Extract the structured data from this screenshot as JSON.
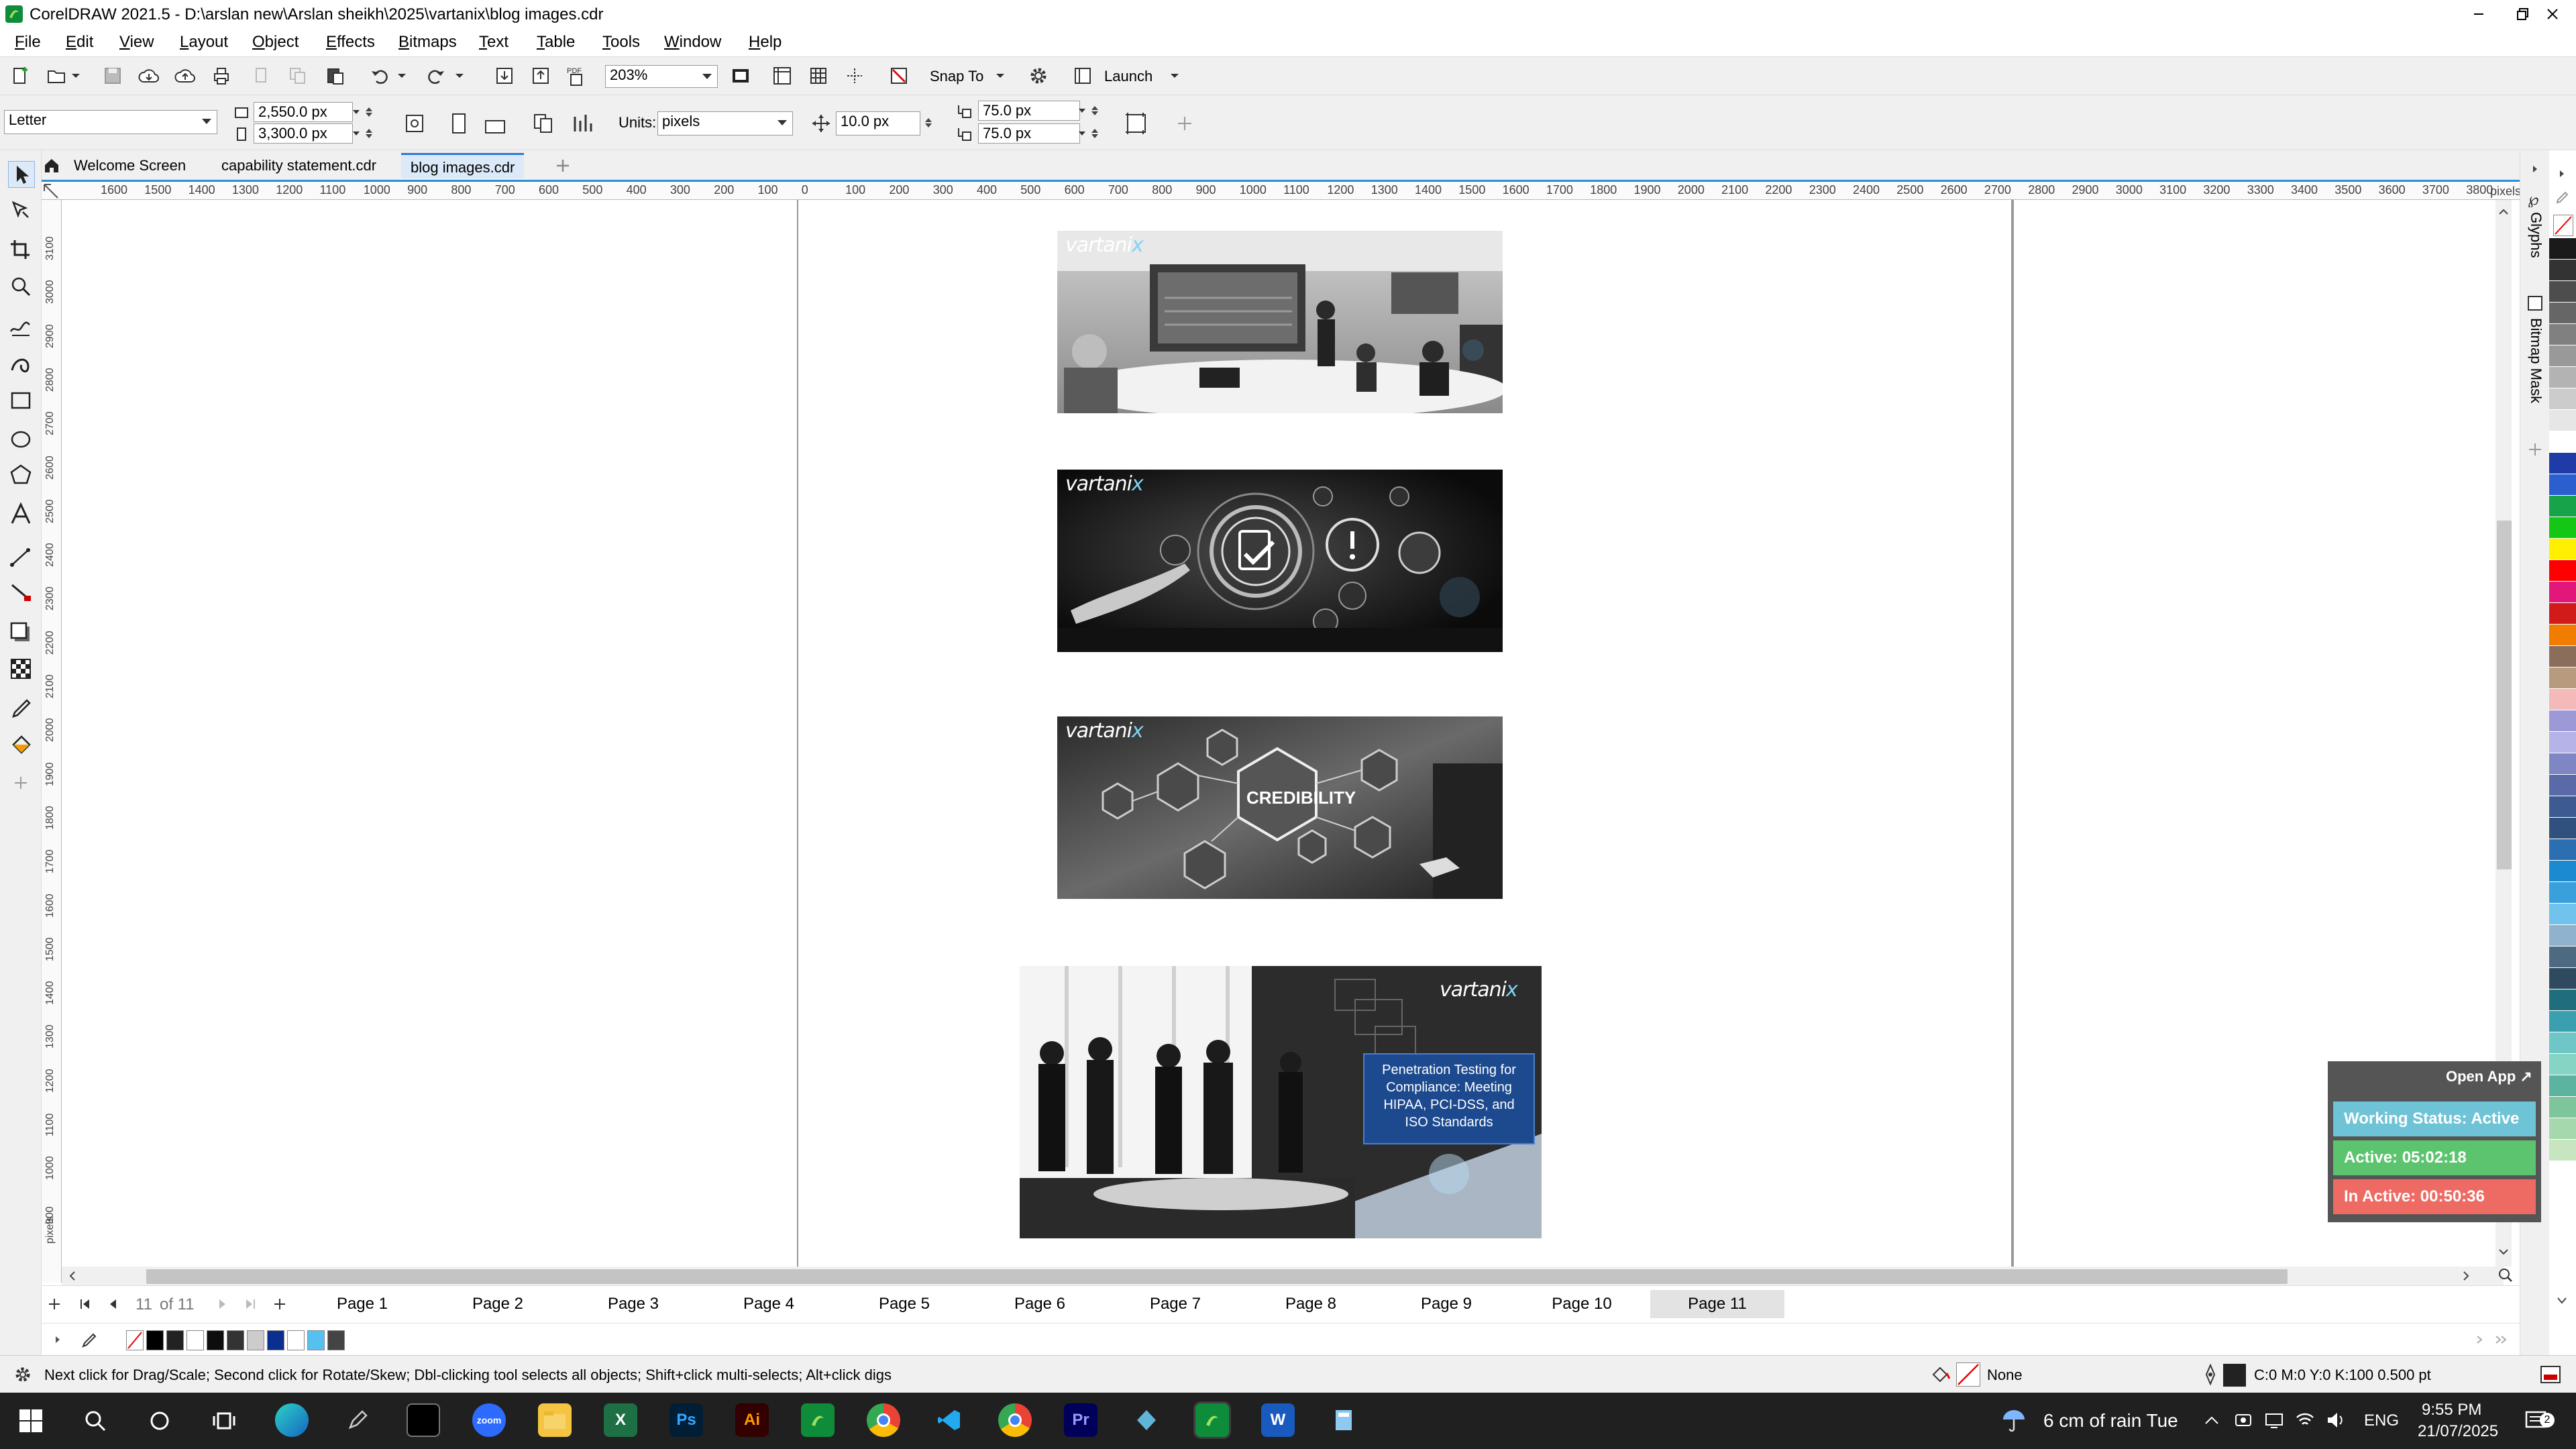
{
  "window": {
    "title": "CorelDRAW 2021.5 - D:\\arslan new\\Arslan sheikh\\2025\\vartanix\\blog images.cdr"
  },
  "menu": [
    "File",
    "Edit",
    "View",
    "Layout",
    "Object",
    "Effects",
    "Bitmaps",
    "Text",
    "Table",
    "Tools",
    "Window",
    "Help"
  ],
  "toolbar": {
    "zoom": "203%",
    "snap_to": "Snap To",
    "launch": "Launch"
  },
  "property_bar": {
    "page_size": "Letter",
    "width": "2,550.0 px",
    "height": "3,300.0 px",
    "units_label": "Units:",
    "units": "pixels",
    "nudge": "10.0 px",
    "dup_x": "75.0 px",
    "dup_y": "75.0 px"
  },
  "tabs": [
    "Welcome Screen",
    "capability statement.cdr",
    "blog images.cdr"
  ],
  "ruler": {
    "h_ticks": [
      "1600",
      "1500",
      "1400",
      "1300",
      "1200",
      "1100",
      "1000",
      "900",
      "800",
      "700",
      "600",
      "500",
      "400",
      "300",
      "200",
      "100",
      "0",
      "100",
      "200",
      "300",
      "400",
      "500",
      "600",
      "700",
      "800",
      "900",
      "1000",
      "1100",
      "1200",
      "1300",
      "1400",
      "1500",
      "1600",
      "1700",
      "1800",
      "1900",
      "2000",
      "2100",
      "2200",
      "2300",
      "2400",
      "2500",
      "2600",
      "2700",
      "2800",
      "2900",
      "3000",
      "3100",
      "3200",
      "3300",
      "3400",
      "3500",
      "3600",
      "3700",
      "3800"
    ],
    "unit": "pixels",
    "v_ticks": [
      "3100",
      "3000",
      "2900",
      "2800",
      "2700",
      "2600",
      "2500",
      "2400",
      "2300",
      "2200",
      "2100",
      "2000",
      "1900",
      "1800",
      "1700",
      "1600",
      "1500",
      "1400",
      "1300",
      "1200",
      "1100",
      "1000",
      "900"
    ],
    "v_unit": "pixels"
  },
  "canvas": {
    "watermark_brand": "vartani",
    "watermark_x": "x",
    "credibility_text": "CREDIBILITY",
    "blog_title": "Penetration Testing for Compliance: Meeting HIPAA, PCI-DSS, and ISO Standards"
  },
  "page_nav": {
    "counter": "11",
    "of": "of 11",
    "pages": [
      "Page 1",
      "Page 2",
      "Page 3",
      "Page 4",
      "Page 5",
      "Page 6",
      "Page 7",
      "Page 8",
      "Page 9",
      "Page 10",
      "Page 11"
    ],
    "active_page": "Page 11"
  },
  "status": {
    "hint": "Next click for Drag/Scale; Second click for Rotate/Skew; Dbl-clicking tool selects all objects; Shift+click multi-selects; Alt+click digs",
    "fill": "None",
    "outline": "C:0 M:0 Y:0 K:100  0.500 pt"
  },
  "dockers": [
    "Glyphs",
    "Bitmap Mask"
  ],
  "widget": {
    "open_app": "Open App ↗",
    "working": "Working Status: Active",
    "active": "Active: 05:02:18",
    "inactive": "In Active: 00:50:36",
    "colors": {
      "working": "#6fc3d6",
      "active": "#5cc46e",
      "inactive": "#ee6b64"
    }
  },
  "taskbar": {
    "weather": "6 cm of rain Tue",
    "lang": "ENG",
    "time": "9:55 PM",
    "date": "21/07/2025"
  },
  "palette": [
    "#1a1a1a",
    "#333333",
    "#4d4d4d",
    "#666666",
    "#808080",
    "#999999",
    "#b3b3b3",
    "#cccccc",
    "#e6e6e6",
    "#ffffff",
    "#1f3ba8",
    "#2b5fd0",
    "#17a34a",
    "#14c714",
    "#ffef00",
    "#ff0000",
    "#e3167a",
    "#d11a1a",
    "#f27c00",
    "#8b6d5c",
    "#b89a7e",
    "#f4b9b9",
    "#9d99d6",
    "#b6b3e8",
    "#7e86c4",
    "#5a6aa8",
    "#3d5a92",
    "#30507e",
    "#2b6fb2",
    "#1b8ad0",
    "#3aa0dc",
    "#6fc3ec",
    "#8fb3cf",
    "#4e6a82",
    "#2f4a5e",
    "#1e6e7e",
    "#3aa0b0",
    "#6fc6c6",
    "#85d4c4",
    "#5cb3a0",
    "#7fc59c",
    "#a6d8ae",
    "#c7e6c0"
  ],
  "doc_palette": [
    "#000000",
    "#222222",
    "#ffffff",
    "#0d0d0d",
    "#333333",
    "#cccccc",
    "#0a2f8f",
    "#ffffff",
    "#56c1f0",
    "#444444"
  ]
}
